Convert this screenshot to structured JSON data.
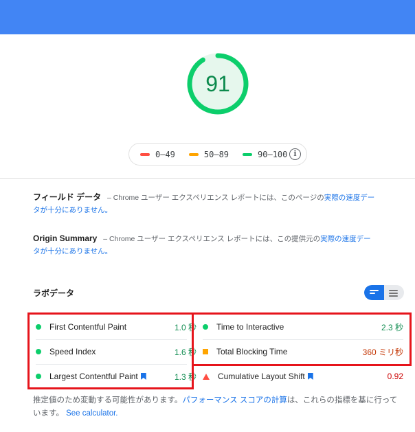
{
  "header": {
    "color": "#4285f4"
  },
  "gauge": {
    "score": "91",
    "fraction": 0.91,
    "color": "#0cce6b"
  },
  "legend": {
    "items": [
      {
        "label": "0–49",
        "color": "#ff4e42"
      },
      {
        "label": "50–89",
        "color": "#ffa400"
      },
      {
        "label": "90–100",
        "color": "#0cce6b"
      }
    ],
    "info_icon": "info-icon"
  },
  "field_data": {
    "title": "フィールド データ",
    "text_before": " – Chrome ユーザー エクスペリエンス レポートには、このページの",
    "link": "実際の速度データが十分にありません。"
  },
  "origin_summary": {
    "title": "Origin Summary",
    "text_before": " – Chrome ユーザー エクスペリエンス レポートには、この提供元の",
    "link": "実際の速度データが十分にありません。"
  },
  "lab": {
    "title": "ラボデータ",
    "metrics_left": [
      {
        "label": "First Contentful Paint",
        "value": "1.0 秒",
        "status": "pass",
        "color": "#0c8a4d",
        "bookmark": false
      },
      {
        "label": "Speed Index",
        "value": "1.6 秒",
        "status": "pass",
        "color": "#0c8a4d",
        "bookmark": false
      },
      {
        "label": "Largest Contentful Paint",
        "value": "1.3 秒",
        "status": "pass",
        "color": "#0c8a4d",
        "bookmark": true
      }
    ],
    "metrics_right": [
      {
        "label": "Time to Interactive",
        "value": "2.3 秒",
        "status": "pass",
        "color": "#0c8a4d",
        "bookmark": false
      },
      {
        "label": "Total Blocking Time",
        "value": "360 ミリ秒",
        "status": "average",
        "color": "#c33300",
        "bookmark": false
      },
      {
        "label": "Cumulative Layout Shift",
        "value": "0.92",
        "status": "fail",
        "color": "#cc0000",
        "bookmark": true
      }
    ]
  },
  "footnote": {
    "text_before": "推定値のため変動する可能性があります。",
    "link1": "パフォーマンス スコアの計算",
    "text_middle": "は、これらの指標を基に行っています。",
    "link2": "See calculator."
  }
}
